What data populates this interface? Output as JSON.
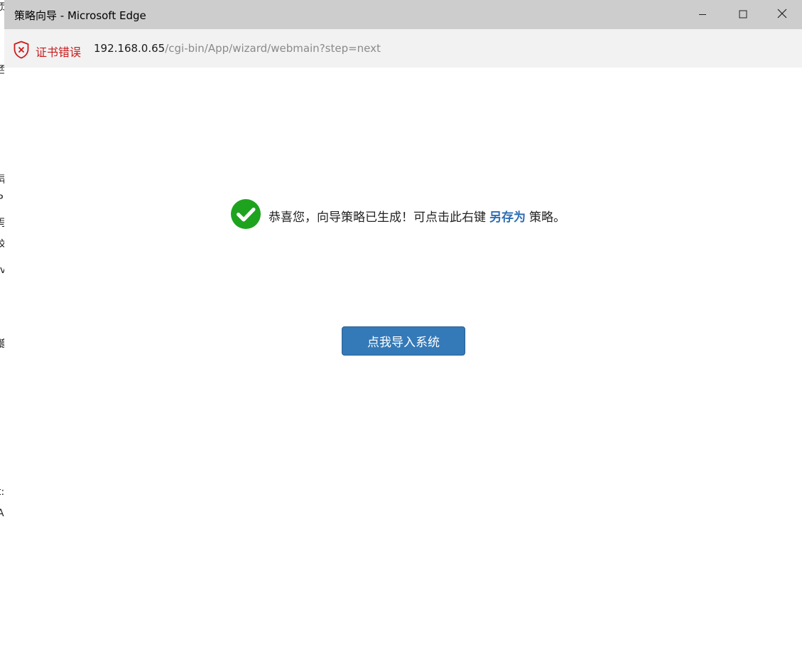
{
  "window": {
    "title": "策略向导 - Microsoft Edge",
    "controls": {
      "minimize_icon": "minimize-icon",
      "maximize_icon": "maximize-icon",
      "close_icon": "close-icon"
    }
  },
  "addressbar": {
    "cert_error_label": "证书错误",
    "cert_icon": "shield-x-icon",
    "url_host": "192.168.0.65",
    "url_path": "/cgi-bin/App/wizard/webmain?step=next"
  },
  "message": {
    "icon": "check-circle-icon",
    "text_before": "恭喜您，向导策略已生成！可点击此右键",
    "save_as_link": "另存为",
    "text_after": "策略。"
  },
  "import_button": {
    "label": "点我导入系统"
  },
  "colors": {
    "titlebar": "#cdcdcd",
    "addressbar": "#f2f2f2",
    "cert_error": "#c91c1c",
    "accent_link": "#2e6db4",
    "button_bg": "#3479b8",
    "success_green": "#1ea31e"
  }
}
